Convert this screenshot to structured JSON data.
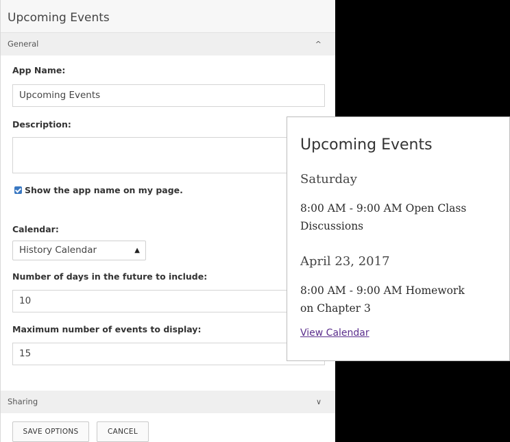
{
  "settings": {
    "title": "Upcoming Events",
    "general_section": {
      "label": "General",
      "chevron": "chevron-up-icon"
    },
    "app_name": {
      "label": "App Name:",
      "value": "Upcoming Events"
    },
    "description": {
      "label": "Description:",
      "value": ""
    },
    "show_app_name": {
      "label": "Show the app name on my page.",
      "checked": true
    },
    "calendar": {
      "label": "Calendar:",
      "selected": "History Calendar"
    },
    "days_future": {
      "label": "Number of days in the future to include:",
      "value": "10"
    },
    "max_events": {
      "label": "Maximum number of events to display:",
      "value": "15"
    },
    "sharing_section": {
      "label": "Sharing",
      "chevron": "chevron-down-icon"
    },
    "buttons": {
      "save": "SAVE OPTIONS",
      "cancel": "CANCEL"
    }
  },
  "preview": {
    "title": "Upcoming Events",
    "groups": [
      {
        "date": "Saturday",
        "event_line1": "8:00 AM - 9:00 AM Open Class",
        "event_line2": "Discussions"
      },
      {
        "date": "April 23, 2017",
        "event_line1": "8:00 AM - 9:00 AM Homework",
        "event_line2": "on Chapter 3"
      }
    ],
    "link": "View Calendar"
  },
  "colors": {
    "checkbox": "#3a78c2",
    "link": "#5a2d8c",
    "section_bar": "#efefef",
    "backdrop": "#000000"
  }
}
